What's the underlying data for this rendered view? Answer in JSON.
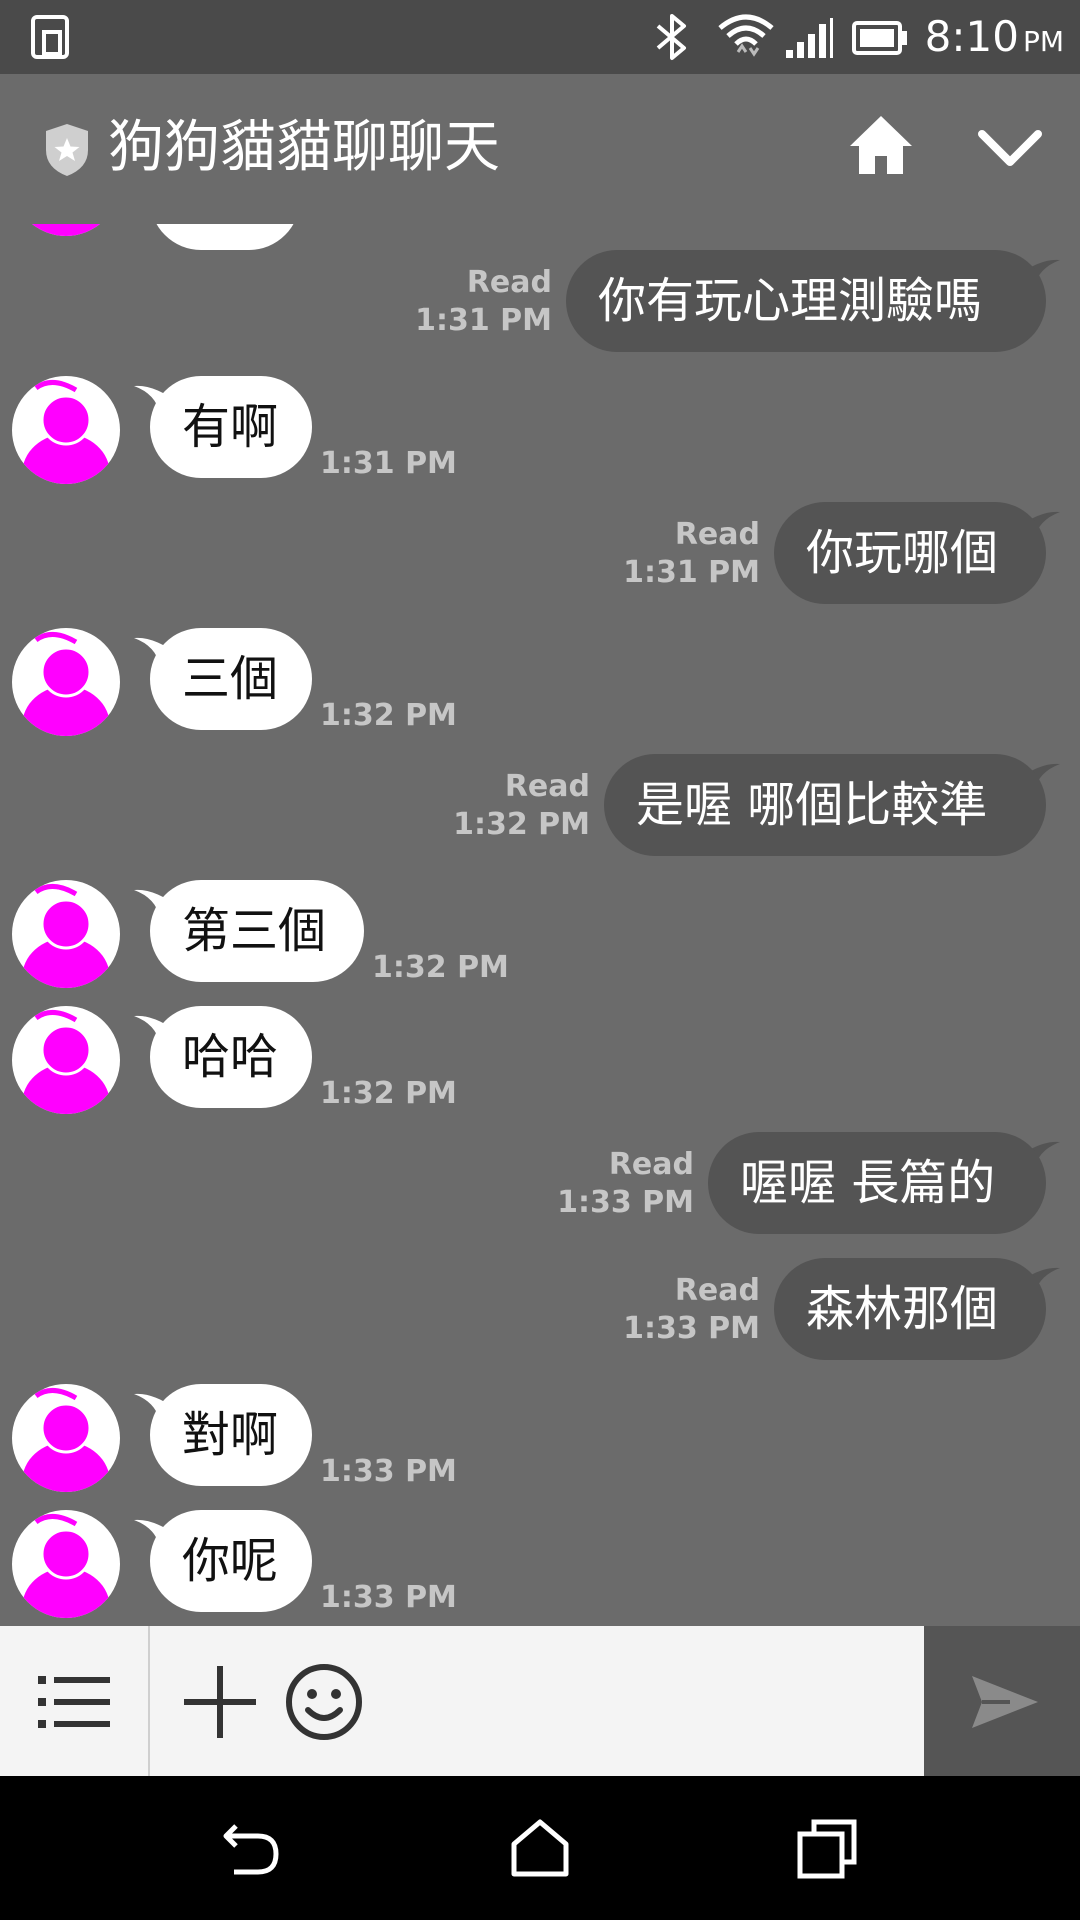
{
  "status_bar": {
    "time": "8:10",
    "ampm": "PM",
    "icons": [
      "phone-mode-icon",
      "bluetooth-icon",
      "wifi-icon",
      "cell-signal-icon",
      "battery-icon"
    ]
  },
  "header": {
    "title": "狗狗貓貓聊聊天",
    "icons": [
      "shield-star-icon",
      "home-icon",
      "chevron-down-icon"
    ]
  },
  "messages": [
    {
      "side": "out",
      "text": "你有玩心理測驗嗎",
      "read": "Read",
      "time": "1:31 PM"
    },
    {
      "side": "in",
      "text": "有啊",
      "time": "1:31 PM"
    },
    {
      "side": "out",
      "text": "你玩哪個",
      "read": "Read",
      "time": "1:31 PM"
    },
    {
      "side": "in",
      "text": "三個",
      "time": "1:32 PM"
    },
    {
      "side": "out",
      "text": "是喔 哪個比較準",
      "read": "Read",
      "time": "1:32 PM"
    },
    {
      "side": "in",
      "text": "第三個",
      "time": "1:32 PM"
    },
    {
      "side": "in",
      "text": "哈哈",
      "time": "1:32 PM"
    },
    {
      "side": "out",
      "text": "喔喔 長篇的",
      "read": "Read",
      "time": "1:33 PM"
    },
    {
      "side": "out",
      "text": "森林那個",
      "read": "Read",
      "time": "1:33 PM"
    },
    {
      "side": "in",
      "text": "對啊",
      "time": "1:33 PM"
    },
    {
      "side": "in",
      "text": "你呢",
      "time": "1:33 PM"
    }
  ],
  "input_bar": {
    "placeholder": "",
    "icons": [
      "menu-list-icon",
      "plus-icon",
      "emoji-icon",
      "send-icon"
    ]
  },
  "nav_bar": {
    "icons": [
      "back-icon",
      "home-icon",
      "recents-icon"
    ]
  },
  "colors": {
    "background": "#6b6b6b",
    "status_bar": "#4a4a4a",
    "incoming_bubble": "#ffffff",
    "outgoing_bubble": "#545454",
    "avatar_accent": "#ff00ff"
  }
}
